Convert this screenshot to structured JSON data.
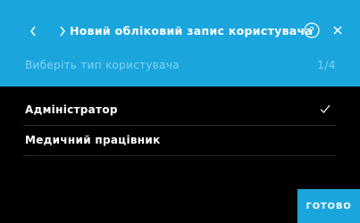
{
  "header": {
    "title": "Новий обліковий запис користувача",
    "subtitle": "Виберіть тип користувача",
    "step": "1/4",
    "icons": {
      "back": "chevron-left-icon",
      "breadcrumb": "chevron-right-icon",
      "help": "help-icon",
      "close": "close-icon"
    }
  },
  "user_types": [
    {
      "label": "Адміністратор",
      "selected": true
    },
    {
      "label": "Медичний працівник",
      "selected": false
    }
  ],
  "footer": {
    "done_label": "ГОТОВО"
  },
  "colors": {
    "accent": "#1aa6dd",
    "subtitle": "#7fd2f3",
    "background": "#000000",
    "text": "#ffffff"
  }
}
